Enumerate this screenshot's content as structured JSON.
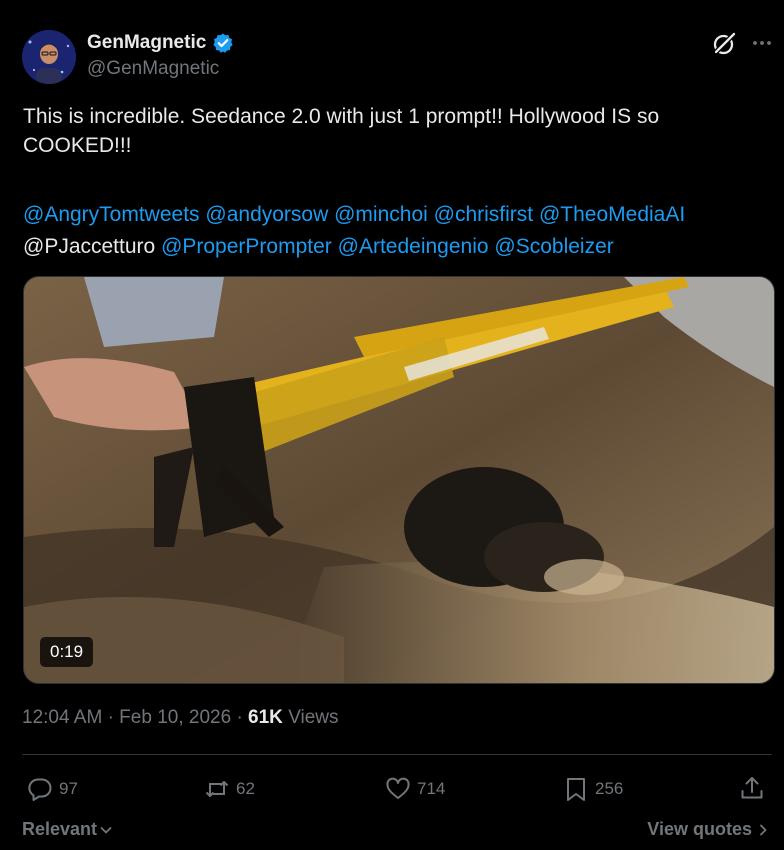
{
  "author": {
    "display_name": "GenMagnetic",
    "handle": "@GenMagnetic",
    "verified": true
  },
  "tweet": {
    "text_line_1": "This is incredible. Seedance 2.0 with just 1 prompt!! Hollywood IS so",
    "text_line_2": "COOKED!!!",
    "mentions_line_1": [
      "@AngryTomtweets",
      "@andyorsow",
      "@minchoi",
      "@chrisfirst",
      "@TheoMediaAI"
    ],
    "mention_plain": "@PJaccetturo",
    "mentions_line_2": [
      "@ProperPrompter",
      "@Artedeingenio",
      "@Scobleizer"
    ]
  },
  "media": {
    "duration": "0:19"
  },
  "meta": {
    "time": "12:04 AM",
    "separator": "·",
    "date": "Feb 10, 2026",
    "views_count": "61K",
    "views_label": "Views"
  },
  "actions": {
    "replies": "97",
    "reposts": "62",
    "likes": "714",
    "bookmarks": "256"
  },
  "footer": {
    "sort_label": "Relevant",
    "view_quotes_label": "View quotes"
  },
  "colors": {
    "background": "#000000",
    "text_primary": "#e7e9ea",
    "text_secondary": "#71767b",
    "accent_blue": "#1d9bf0",
    "divider": "#2f3336"
  },
  "icons": [
    "verified-badge-icon",
    "grok-icon",
    "more-options-icon",
    "reply-icon",
    "repost-icon",
    "like-icon",
    "bookmark-icon",
    "share-icon",
    "chevron-down-icon",
    "chevron-right-icon"
  ]
}
